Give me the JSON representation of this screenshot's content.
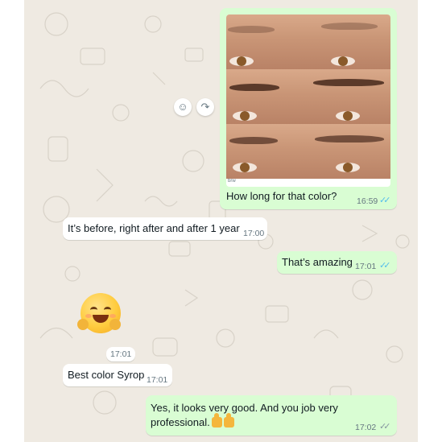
{
  "messages": [
    {
      "id": "m1",
      "direction": "outgoing",
      "has_image": true,
      "image_caption": "brw",
      "text": "How long for that color?",
      "time": "16:59",
      "ticks": "read"
    },
    {
      "id": "m2",
      "direction": "incoming",
      "text": "It’s before, right after and after 1 year",
      "time": "17:00"
    },
    {
      "id": "m3",
      "direction": "outgoing",
      "text": "That’s amazing",
      "time": "17:01",
      "ticks": "read"
    },
    {
      "id": "m4",
      "direction": "incoming",
      "sticker": "hugging-face-emoji",
      "time": "17:01"
    },
    {
      "id": "m5",
      "direction": "incoming",
      "text": "Best color Syrop",
      "time": "17:01"
    },
    {
      "id": "m6",
      "direction": "outgoing",
      "text": "Yes, it looks very good. And you job very professional.",
      "emoji_suffix": "thumbs-up x2",
      "time": "17:02",
      "ticks": "delivered"
    }
  ],
  "actions": {
    "react_icon": "smiley-icon",
    "forward_icon": "forward-icon"
  },
  "colors": {
    "chat_bg": "#efeae2",
    "outgoing": "#d9fdd3",
    "incoming": "#ffffff",
    "read_ticks": "#53bdeb",
    "time": "#667781"
  }
}
